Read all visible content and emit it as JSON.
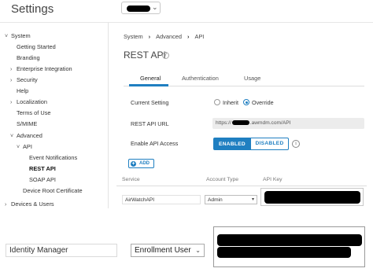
{
  "header": {
    "app_title": "Settings",
    "org_chevron_icon": "chevron-down-icon"
  },
  "sidebar": {
    "items": [
      {
        "label": "System",
        "arrow": "˅"
      },
      {
        "label": "Getting Started"
      },
      {
        "label": "Branding"
      },
      {
        "label": "Enterprise Integration",
        "arrow": "›"
      },
      {
        "label": "Security",
        "arrow": "›"
      },
      {
        "label": "Help"
      },
      {
        "label": "Localization",
        "arrow": "›"
      },
      {
        "label": "Terms of Use"
      },
      {
        "label": "S/MIME"
      },
      {
        "label": "Advanced",
        "arrow": "˅"
      },
      {
        "label": "API",
        "arrow": "˅"
      },
      {
        "label": "Event Notifications"
      },
      {
        "label": "REST API",
        "selected": true
      },
      {
        "label": "SOAP API"
      },
      {
        "label": "Device Root Certificate"
      },
      {
        "label": "Devices & Users",
        "arrow": "›"
      }
    ]
  },
  "breadcrumb": {
    "items": [
      "System",
      "Advanced",
      "API"
    ],
    "separator": "›"
  },
  "page": {
    "title": "REST API",
    "help_icon": "question-circle-icon",
    "help_glyph": "?"
  },
  "tabs": [
    {
      "label": "General",
      "active": true
    },
    {
      "label": "Authentication"
    },
    {
      "label": "Usage"
    }
  ],
  "form": {
    "current_setting_label": "Current Setting",
    "inherit_label": "Inherit",
    "override_label": "Override",
    "selected_option": "Override",
    "rest_api_url_label": "REST API URL",
    "url_prefix": "https://",
    "url_suffix": ".awmdm.com/API",
    "enable_api_access_label": "Enable API Access",
    "enabled_label": "ENABLED",
    "disabled_label": "DISABLED",
    "enabled_state": true,
    "info_icon": "info-circle-icon",
    "info_glyph": "i"
  },
  "table": {
    "add_label": "ADD",
    "add_glyph": "+",
    "columns": [
      "Service",
      "Account Type",
      "API Key"
    ],
    "rows": [
      {
        "service": "AirWatchAPI",
        "account_type": "Admin"
      }
    ]
  },
  "overlay_row": {
    "service": "Identity Manager",
    "account_type": "Enrollment User"
  },
  "colors": {
    "accent": "#1f7fc1",
    "redaction": "#000000"
  }
}
